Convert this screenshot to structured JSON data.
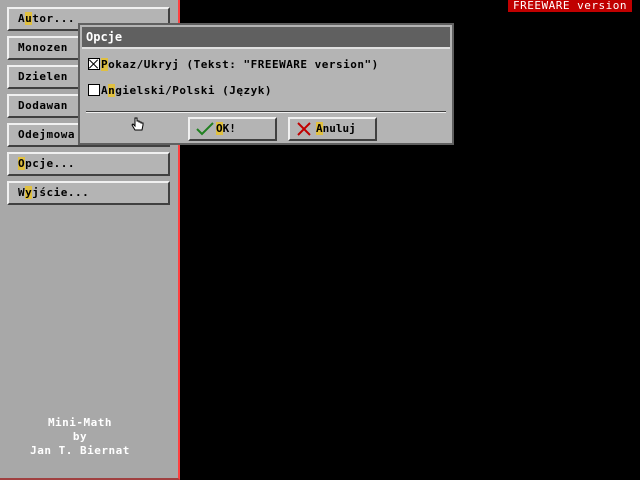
{
  "badge": "FREEWARE version",
  "sidebar": {
    "items": [
      {
        "pre": "A",
        "hot": "u",
        "post": "tor..."
      },
      {
        "pre": "",
        "hot": "",
        "post": "Monozen"
      },
      {
        "pre": "",
        "hot": "",
        "post": "Dzielen"
      },
      {
        "pre": "",
        "hot": "",
        "post": "Dodawan"
      },
      {
        "pre": "",
        "hot": "",
        "post": "Odejmowa"
      },
      {
        "pre": "",
        "hot": "O",
        "post": "pcje..."
      },
      {
        "pre": "W",
        "hot": "y",
        "post": "jście..."
      }
    ],
    "credits": [
      "Mini-Math",
      "by",
      "Jan T. Biernat"
    ]
  },
  "dialog": {
    "title": "Opcje",
    "options": [
      {
        "checked": true,
        "hot": "P",
        "rest": "okaz/Ukryj (Tekst: \"FREEWARE version\")"
      },
      {
        "checked": false,
        "pre": "A",
        "hot": "n",
        "rest": "gielski/Polski (Język)"
      }
    ],
    "ok": {
      "hot": "O",
      "rest": "K!"
    },
    "cancel": {
      "hot": "A",
      "rest": "nuluj"
    }
  },
  "colors": {
    "accent": "#c00000",
    "hotkey": "#e0c040",
    "panel": "#b4b4b4",
    "titlebar": "#606060"
  }
}
